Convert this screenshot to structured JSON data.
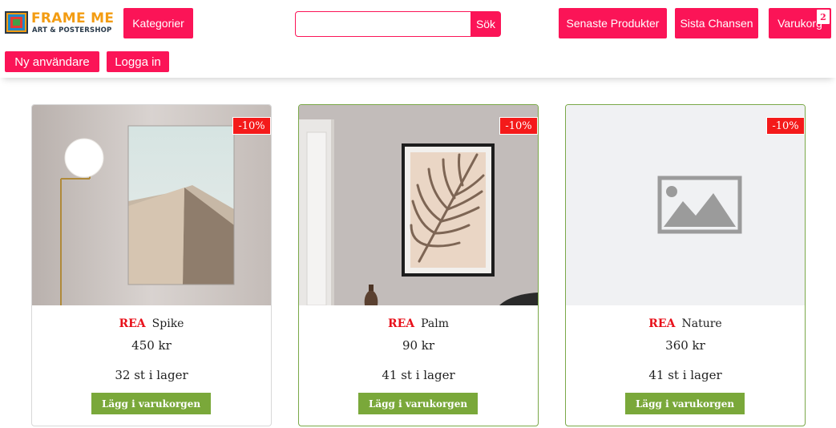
{
  "brand": {
    "title": "FRAME ME",
    "subtitle": "ART & POSTERSHOP"
  },
  "nav": {
    "categories_label": "Kategorier",
    "search_placeholder": "",
    "search_value": "",
    "search_button": "Sök",
    "latest_label": "Senaste Produkter",
    "last_chance_label": "Sista Chansen",
    "cart_label": "Varukorg",
    "cart_count": "2",
    "new_user_label": "Ny användare",
    "login_label": "Logga in"
  },
  "colors": {
    "primary": "#fb1457",
    "sale": "#e8101a",
    "add_button": "#7aa83a",
    "logo_orange": "#f39c12"
  },
  "products": [
    {
      "discount": "-10%",
      "sale_tag": "REA",
      "name": "Spike",
      "price": "450 kr",
      "stock": "32 st i lager",
      "add_label": "Lägg i varukorgen",
      "image": "desert-dune-poster"
    },
    {
      "discount": "-10%",
      "sale_tag": "REA",
      "name": "Palm",
      "price": "90 kr",
      "stock": "41 st i lager",
      "add_label": "Lägg i varukorgen",
      "image": "palm-leaf-poster"
    },
    {
      "discount": "-10%",
      "sale_tag": "REA",
      "name": "Nature",
      "price": "360 kr",
      "stock": "41 st i lager",
      "add_label": "Lägg i varukorgen",
      "image": "image-placeholder-icon"
    }
  ]
}
